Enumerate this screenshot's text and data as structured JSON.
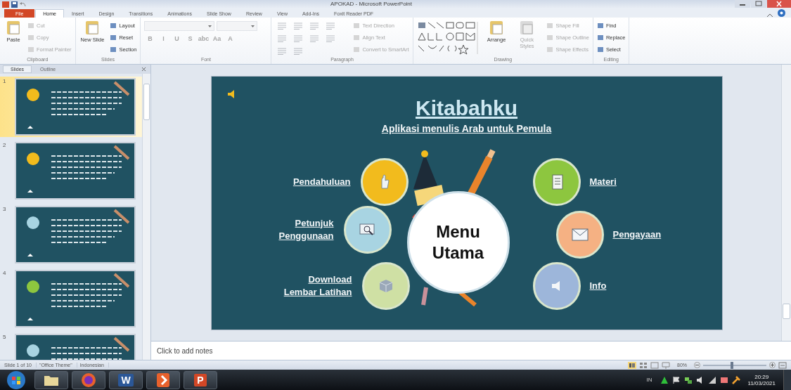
{
  "window": {
    "title": "APOKAD - Microsoft PowerPoint"
  },
  "ribbon_tabs": [
    {
      "label": "File",
      "kind": "file",
      "selected": false
    },
    {
      "label": "Home",
      "kind": "tab",
      "selected": true
    },
    {
      "label": "Insert",
      "kind": "tab",
      "selected": false
    },
    {
      "label": "Design",
      "kind": "tab",
      "selected": false
    },
    {
      "label": "Transitions",
      "kind": "tab",
      "selected": false
    },
    {
      "label": "Animations",
      "kind": "tab",
      "selected": false
    },
    {
      "label": "Slide Show",
      "kind": "tab",
      "selected": false
    },
    {
      "label": "Review",
      "kind": "tab",
      "selected": false
    },
    {
      "label": "View",
      "kind": "tab",
      "selected": false
    },
    {
      "label": "Add-Ins",
      "kind": "tab",
      "selected": false
    },
    {
      "label": "Foxit Reader PDF",
      "kind": "tab",
      "selected": false
    }
  ],
  "ribbon": {
    "groups": [
      {
        "label": "Clipboard",
        "buttons": [
          {
            "label": "Paste",
            "kind": "large",
            "disabled": false
          },
          {
            "label": "Cut",
            "kind": "small",
            "disabled": true
          },
          {
            "label": "Copy",
            "kind": "small",
            "disabled": true
          },
          {
            "label": "Format Painter",
            "kind": "small",
            "disabled": true
          }
        ]
      },
      {
        "label": "Slides",
        "buttons": [
          {
            "label": "New Slide",
            "kind": "large",
            "disabled": false
          },
          {
            "label": "Layout",
            "kind": "small",
            "disabled": false
          },
          {
            "label": "Reset",
            "kind": "small",
            "disabled": false
          },
          {
            "label": "Section",
            "kind": "small",
            "disabled": false
          }
        ]
      },
      {
        "label": "Font",
        "buttons": [
          {
            "kind": "field",
            "disabled": true
          },
          {
            "kind": "field",
            "disabled": true
          },
          {
            "label": "B",
            "kind": "format",
            "disabled": true
          },
          {
            "label": "I",
            "kind": "format",
            "disabled": true
          },
          {
            "label": "U",
            "kind": "format",
            "disabled": true
          },
          {
            "label": "S",
            "kind": "format",
            "disabled": true
          },
          {
            "label": "abc",
            "kind": "format",
            "disabled": true
          },
          {
            "label": "Aa",
            "kind": "format",
            "disabled": true
          },
          {
            "label": "A",
            "kind": "format",
            "disabled": true
          }
        ]
      },
      {
        "label": "Paragraph",
        "buttons": [
          {
            "kind": "icon",
            "disabled": true
          },
          {
            "kind": "icon",
            "disabled": true
          },
          {
            "kind": "icon",
            "disabled": true
          },
          {
            "kind": "icon",
            "disabled": true
          },
          {
            "kind": "icon",
            "disabled": true
          },
          {
            "kind": "icon",
            "disabled": true
          },
          {
            "kind": "icon",
            "disabled": true
          },
          {
            "kind": "icon",
            "disabled": true
          },
          {
            "kind": "icon",
            "disabled": true
          },
          {
            "kind": "icon",
            "disabled": true
          },
          {
            "label": "Text Direction",
            "kind": "small",
            "disabled": true
          },
          {
            "label": "Align Text",
            "kind": "small",
            "disabled": true
          },
          {
            "label": "Convert to SmartArt",
            "kind": "small",
            "disabled": true
          }
        ]
      },
      {
        "label": "Drawing",
        "buttons": [
          {
            "kind": "gallery",
            "disabled": false
          },
          {
            "label": "Arrange",
            "kind": "large",
            "disabled": false
          },
          {
            "label": "Quick Styles",
            "kind": "large",
            "disabled": true
          },
          {
            "label": "Shape Fill",
            "kind": "small",
            "disabled": true
          },
          {
            "label": "Shape Outline",
            "kind": "small",
            "disabled": true
          },
          {
            "label": "Shape Effects",
            "kind": "small",
            "disabled": true
          }
        ]
      },
      {
        "label": "Editing",
        "buttons": [
          {
            "label": "Find",
            "kind": "small",
            "disabled": false
          },
          {
            "label": "Replace",
            "kind": "small",
            "disabled": false
          },
          {
            "label": "Select",
            "kind": "small",
            "disabled": false
          }
        ]
      }
    ]
  },
  "slide_panel": {
    "tabs": [
      {
        "label": "Slides",
        "selected": true
      },
      {
        "label": "Outline",
        "selected": false
      }
    ],
    "thumbnails": [
      {
        "number": "1",
        "selected": true
      },
      {
        "number": "2",
        "selected": false
      },
      {
        "number": "3",
        "selected": false
      },
      {
        "number": "4",
        "selected": false
      },
      {
        "number": "5",
        "selected": false
      }
    ]
  },
  "slide": {
    "title": "Kitabahku",
    "subtitle": "Aplikasi menulis Arab untuk Pemula",
    "center": [
      "Menu",
      "Utama"
    ],
    "items": [
      {
        "label": [
          "Pendahuluan"
        ],
        "kind": "hand",
        "color": "#f2bb1d"
      },
      {
        "label": [
          "Petunjuk",
          "Penggunaan"
        ],
        "kind": "search",
        "color": "#a8d4e2"
      },
      {
        "label": [
          "Download",
          "Lembar Latihan"
        ],
        "kind": "cube",
        "color": "#cfe0a4"
      },
      {
        "label": [
          "Materi"
        ],
        "kind": "document",
        "color": "#8dc63f"
      },
      {
        "label": [
          "Pengayaan"
        ],
        "kind": "envelope",
        "color": "#f5b183"
      },
      {
        "label": [
          "Info"
        ],
        "kind": "speaker",
        "color": "#9db6da"
      }
    ]
  },
  "notes": {
    "placeholder": "Click to add notes"
  },
  "status_bar": {
    "slide": "Slide 1 of 10",
    "theme": "\"Office Theme\"",
    "language": "Indonesian",
    "zoom": "80%",
    "zoom_level": {
      "level": 0.45
    }
  },
  "taskbar": {
    "apps": [
      {
        "kind": "folder"
      },
      {
        "kind": "browser"
      },
      {
        "kind": "word",
        "label": "W"
      },
      {
        "kind": "app"
      },
      {
        "kind": "powerpoint",
        "label": "P"
      }
    ],
    "language": "IN",
    "time": "20:29",
    "date": "11/03/2021"
  }
}
